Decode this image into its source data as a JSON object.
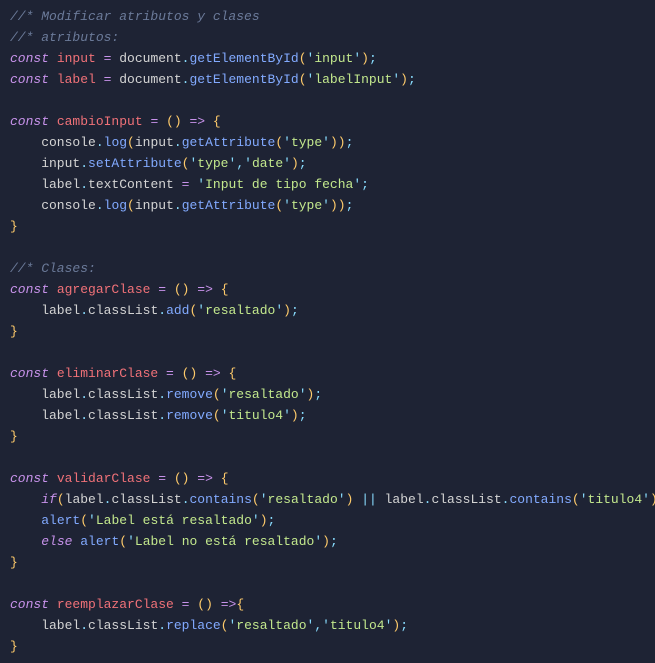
{
  "lines": [
    [
      [
        "comment",
        "//* Modificar atributos y clases"
      ]
    ],
    [
      [
        "comment",
        "//* atributos:"
      ]
    ],
    [
      [
        "kw-const",
        "const "
      ],
      [
        "var-decl",
        "input"
      ],
      [
        "ident",
        " "
      ],
      [
        "eq",
        "="
      ],
      [
        "ident",
        " document"
      ],
      [
        "dot",
        "."
      ],
      [
        "func",
        "getElementById"
      ],
      [
        "paren",
        "("
      ],
      [
        "punct",
        "'"
      ],
      [
        "str",
        "input"
      ],
      [
        "punct",
        "'"
      ],
      [
        "paren",
        ")"
      ],
      [
        "semi",
        ";"
      ]
    ],
    [
      [
        "kw-const",
        "const "
      ],
      [
        "var-decl",
        "label"
      ],
      [
        "ident",
        " "
      ],
      [
        "eq",
        "="
      ],
      [
        "ident",
        " document"
      ],
      [
        "dot",
        "."
      ],
      [
        "func",
        "getElementById"
      ],
      [
        "paren",
        "("
      ],
      [
        "punct",
        "'"
      ],
      [
        "str",
        "labelInput"
      ],
      [
        "punct",
        "'"
      ],
      [
        "paren",
        ")"
      ],
      [
        "semi",
        ";"
      ]
    ],
    [
      [
        "ident",
        ""
      ]
    ],
    [
      [
        "kw-const",
        "const "
      ],
      [
        "var-decl",
        "cambioInput"
      ],
      [
        "ident",
        " "
      ],
      [
        "eq",
        "="
      ],
      [
        "ident",
        " "
      ],
      [
        "paren",
        "()"
      ],
      [
        "ident",
        " "
      ],
      [
        "arrow",
        "=>"
      ],
      [
        "ident",
        " "
      ],
      [
        "brace",
        "{"
      ]
    ],
    [
      [
        "ident",
        "    console"
      ],
      [
        "dot",
        "."
      ],
      [
        "func",
        "log"
      ],
      [
        "paren",
        "("
      ],
      [
        "ident",
        "input"
      ],
      [
        "dot",
        "."
      ],
      [
        "func",
        "getAttribute"
      ],
      [
        "paren",
        "("
      ],
      [
        "punct",
        "'"
      ],
      [
        "str",
        "type"
      ],
      [
        "punct",
        "'"
      ],
      [
        "paren",
        "))"
      ],
      [
        "semi",
        ";"
      ]
    ],
    [
      [
        "ident",
        "    input"
      ],
      [
        "dot",
        "."
      ],
      [
        "func",
        "setAttribute"
      ],
      [
        "paren",
        "("
      ],
      [
        "punct",
        "'"
      ],
      [
        "str",
        "type"
      ],
      [
        "punct",
        "'"
      ],
      [
        "punct",
        ","
      ],
      [
        "punct",
        "'"
      ],
      [
        "str",
        "date"
      ],
      [
        "punct",
        "'"
      ],
      [
        "paren",
        ")"
      ],
      [
        "semi",
        ";"
      ]
    ],
    [
      [
        "ident",
        "    label"
      ],
      [
        "dot",
        "."
      ],
      [
        "prop",
        "textContent"
      ],
      [
        "ident",
        " "
      ],
      [
        "eq",
        "="
      ],
      [
        "ident",
        " "
      ],
      [
        "punct",
        "'"
      ],
      [
        "str",
        "Input de tipo fecha"
      ],
      [
        "punct",
        "'"
      ],
      [
        "semi",
        ";"
      ]
    ],
    [
      [
        "ident",
        "    console"
      ],
      [
        "dot",
        "."
      ],
      [
        "func",
        "log"
      ],
      [
        "paren",
        "("
      ],
      [
        "ident",
        "input"
      ],
      [
        "dot",
        "."
      ],
      [
        "func",
        "getAttribute"
      ],
      [
        "paren",
        "("
      ],
      [
        "punct",
        "'"
      ],
      [
        "str",
        "type"
      ],
      [
        "punct",
        "'"
      ],
      [
        "paren",
        "))"
      ],
      [
        "semi",
        ";"
      ]
    ],
    [
      [
        "brace",
        "}"
      ]
    ],
    [
      [
        "ident",
        ""
      ]
    ],
    [
      [
        "comment",
        "//* Clases:"
      ]
    ],
    [
      [
        "kw-const",
        "const "
      ],
      [
        "var-decl",
        "agregarClase"
      ],
      [
        "ident",
        " "
      ],
      [
        "eq",
        "="
      ],
      [
        "ident",
        " "
      ],
      [
        "paren",
        "()"
      ],
      [
        "ident",
        " "
      ],
      [
        "arrow",
        "=>"
      ],
      [
        "ident",
        " "
      ],
      [
        "brace",
        "{"
      ]
    ],
    [
      [
        "ident",
        "    label"
      ],
      [
        "dot",
        "."
      ],
      [
        "prop",
        "classList"
      ],
      [
        "dot",
        "."
      ],
      [
        "func",
        "add"
      ],
      [
        "paren",
        "("
      ],
      [
        "punct",
        "'"
      ],
      [
        "str",
        "resaltado"
      ],
      [
        "punct",
        "'"
      ],
      [
        "paren",
        ")"
      ],
      [
        "semi",
        ";"
      ]
    ],
    [
      [
        "brace",
        "}"
      ]
    ],
    [
      [
        "ident",
        ""
      ]
    ],
    [
      [
        "kw-const",
        "const "
      ],
      [
        "var-decl",
        "eliminarClase"
      ],
      [
        "ident",
        " "
      ],
      [
        "eq",
        "="
      ],
      [
        "ident",
        " "
      ],
      [
        "paren",
        "()"
      ],
      [
        "ident",
        " "
      ],
      [
        "arrow",
        "=>"
      ],
      [
        "ident",
        " "
      ],
      [
        "brace",
        "{"
      ]
    ],
    [
      [
        "ident",
        "    label"
      ],
      [
        "dot",
        "."
      ],
      [
        "prop",
        "classList"
      ],
      [
        "dot",
        "."
      ],
      [
        "func",
        "remove"
      ],
      [
        "paren",
        "("
      ],
      [
        "punct",
        "'"
      ],
      [
        "str",
        "resaltado"
      ],
      [
        "punct",
        "'"
      ],
      [
        "paren",
        ")"
      ],
      [
        "semi",
        ";"
      ]
    ],
    [
      [
        "ident",
        "    label"
      ],
      [
        "dot",
        "."
      ],
      [
        "prop",
        "classList"
      ],
      [
        "dot",
        "."
      ],
      [
        "func",
        "remove"
      ],
      [
        "paren",
        "("
      ],
      [
        "punct",
        "'"
      ],
      [
        "str",
        "titulo4"
      ],
      [
        "punct",
        "'"
      ],
      [
        "paren",
        ")"
      ],
      [
        "semi",
        ";"
      ]
    ],
    [
      [
        "brace",
        "}"
      ]
    ],
    [
      [
        "ident",
        ""
      ]
    ],
    [
      [
        "kw-const",
        "const "
      ],
      [
        "var-decl",
        "validarClase"
      ],
      [
        "ident",
        " "
      ],
      [
        "eq",
        "="
      ],
      [
        "ident",
        " "
      ],
      [
        "paren",
        "()"
      ],
      [
        "ident",
        " "
      ],
      [
        "arrow",
        "=>"
      ],
      [
        "ident",
        " "
      ],
      [
        "brace",
        "{"
      ]
    ],
    [
      [
        "ident",
        "    "
      ],
      [
        "kw-flow",
        "if"
      ],
      [
        "paren",
        "("
      ],
      [
        "ident",
        "label"
      ],
      [
        "dot",
        "."
      ],
      [
        "prop",
        "classList"
      ],
      [
        "dot",
        "."
      ],
      [
        "func",
        "contains"
      ],
      [
        "paren",
        "("
      ],
      [
        "punct",
        "'"
      ],
      [
        "str",
        "resaltado"
      ],
      [
        "punct",
        "'"
      ],
      [
        "paren",
        ")"
      ],
      [
        "ident",
        " "
      ],
      [
        "punct",
        "||"
      ],
      [
        "ident",
        " label"
      ],
      [
        "dot",
        "."
      ],
      [
        "prop",
        "classList"
      ],
      [
        "dot",
        "."
      ],
      [
        "func",
        "contains"
      ],
      [
        "paren",
        "("
      ],
      [
        "punct",
        "'"
      ],
      [
        "str",
        "titulo4"
      ],
      [
        "punct",
        "'"
      ],
      [
        "paren",
        "))"
      ]
    ],
    [
      [
        "ident",
        "    "
      ],
      [
        "func",
        "alert"
      ],
      [
        "paren",
        "("
      ],
      [
        "punct",
        "'"
      ],
      [
        "str",
        "Label está resaltado"
      ],
      [
        "punct",
        "'"
      ],
      [
        "paren",
        ")"
      ],
      [
        "semi",
        ";"
      ]
    ],
    [
      [
        "ident",
        "    "
      ],
      [
        "kw-flow",
        "else"
      ],
      [
        "ident",
        " "
      ],
      [
        "func",
        "alert"
      ],
      [
        "paren",
        "("
      ],
      [
        "punct",
        "'"
      ],
      [
        "str",
        "Label no está resaltado"
      ],
      [
        "punct",
        "'"
      ],
      [
        "paren",
        ")"
      ],
      [
        "semi",
        ";"
      ]
    ],
    [
      [
        "brace",
        "}"
      ]
    ],
    [
      [
        "ident",
        ""
      ]
    ],
    [
      [
        "kw-const",
        "const "
      ],
      [
        "var-decl",
        "reemplazarClase"
      ],
      [
        "ident",
        " "
      ],
      [
        "eq",
        "="
      ],
      [
        "ident",
        " "
      ],
      [
        "paren",
        "()"
      ],
      [
        "ident",
        " "
      ],
      [
        "arrow",
        "=>"
      ],
      [
        "brace",
        "{"
      ]
    ],
    [
      [
        "ident",
        "    label"
      ],
      [
        "dot",
        "."
      ],
      [
        "prop",
        "classList"
      ],
      [
        "dot",
        "."
      ],
      [
        "func",
        "replace"
      ],
      [
        "paren",
        "("
      ],
      [
        "punct",
        "'"
      ],
      [
        "str",
        "resaltado"
      ],
      [
        "punct",
        "'"
      ],
      [
        "punct",
        ","
      ],
      [
        "punct",
        "'"
      ],
      [
        "str",
        "titulo4"
      ],
      [
        "punct",
        "'"
      ],
      [
        "paren",
        ")"
      ],
      [
        "semi",
        ";"
      ]
    ],
    [
      [
        "brace",
        "}"
      ]
    ]
  ]
}
